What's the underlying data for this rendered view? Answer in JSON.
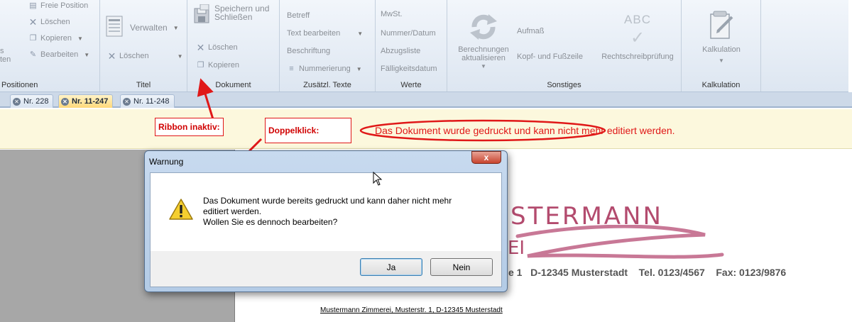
{
  "ribbon": {
    "positionen": {
      "freie_position": "Freie Position",
      "loeschen": "Löschen",
      "kopieren": "Kopieren",
      "bearbeiten": "Bearbeiten",
      "edge_top": "s",
      "edge_bottom": "ten",
      "label": "Positionen"
    },
    "titel": {
      "verwalten": "Verwalten",
      "loeschen": "Löschen",
      "label": "Titel"
    },
    "dokument": {
      "speichern_line1": "Speichern und",
      "speichern_line2": "Schließen",
      "loeschen": "Löschen",
      "kopieren": "Kopieren",
      "label": "Dokument"
    },
    "zusaetzl_texte": {
      "betreff": "Betreff",
      "text_bearbeiten": "Text bearbeiten",
      "beschriftung": "Beschriftung",
      "nummerierung": "Nummerierung",
      "label": "Zusätzl. Texte"
    },
    "werte": {
      "mwst": "MwSt.",
      "nummer_datum": "Nummer/Datum",
      "abzugsliste": "Abzugsliste",
      "faelligkeitsdatum": "Fälligkeitsdatum",
      "label": "Werte"
    },
    "sonstiges": {
      "berechnungen_line1": "Berechnungen",
      "berechnungen_line2": "aktualisieren",
      "aufmass": "Aufmaß",
      "kopf_fusszeile": "Kopf- und Fußzeile",
      "rechtschreibpruefung": "Rechtschreibprüfung",
      "abc_icon_text": "ABC",
      "label": "Sonstiges"
    },
    "kalkulation": {
      "button": "Kalkulation",
      "label": "Kalkulation"
    }
  },
  "tabs": [
    {
      "label": "Nr. 228",
      "active": false
    },
    {
      "label": "Nr. 11-247",
      "active": true
    },
    {
      "label": "Nr. 11-248",
      "active": false
    }
  ],
  "infobar": {
    "message": "Das Dokument wurde gedruckt und kann nicht mehr editiert werden."
  },
  "annotations": {
    "ribbon_inaktiv": "Ribbon inaktiv:",
    "doppelklick": "Doppelklick:",
    "color": "#e01818"
  },
  "document": {
    "company_partial": "STERMANN",
    "subtitle_partial": "EI",
    "contact_partial": "e 1",
    "city": "D-12345 Musterstadt",
    "tel": "Tel. 0123/4567",
    "fax": "Fax: 0123/9876",
    "sender_line": "Mustermann Zimmerei, Musterstr. 1, D-12345 Musterstadt",
    "logo_color": "#b34b6e"
  },
  "dialog": {
    "title": "Warnung",
    "close_glyph": "x",
    "line1": "Das Dokument wurde bereits gedruckt und kann daher nicht mehr",
    "line2": "editiert werden.",
    "line3": "Wollen Sie es dennoch bearbeiten?",
    "yes": "Ja",
    "no": "Nein",
    "icon": "warning-icon"
  }
}
